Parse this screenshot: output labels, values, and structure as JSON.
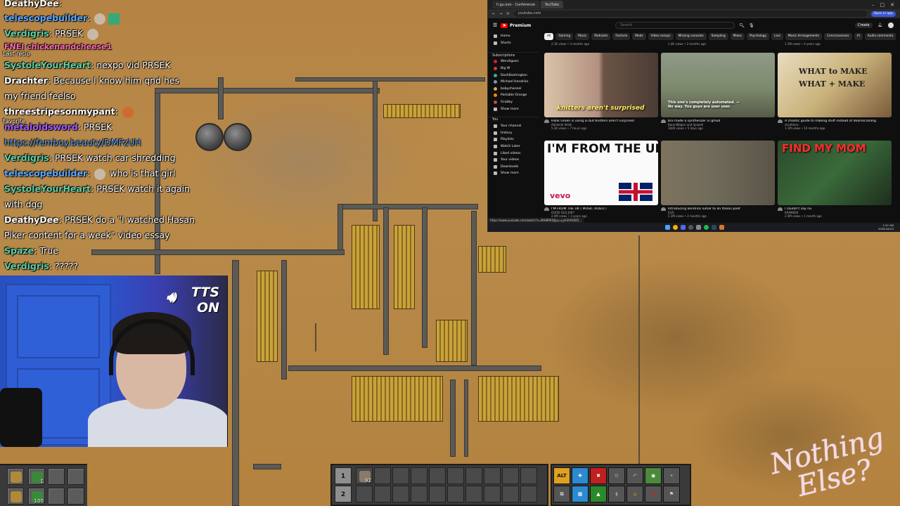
{
  "chat": {
    "messages": [
      {
        "user": "DeathyDee",
        "text": "",
        "color": "#ffffff"
      },
      {
        "user": "telescopebuilder",
        "text": "",
        "color": "#5da9ff"
      },
      {
        "user": "Verdigris",
        "text": "PRSEK",
        "color": "#5fcfa5"
      },
      {
        "user": "FNEI chickenandcheese1",
        "text": "",
        "color": "#ff6ab0"
      },
      {
        "user": "SystoleYourHeart",
        "text": "nexpo vid PRSEK",
        "color": "#5fcfa5"
      },
      {
        "user": "Drachter",
        "text": "Because I know him qnd hes my friend feelso",
        "color": "#ffffff"
      },
      {
        "user": "threestripesonmypant",
        "text": "",
        "color": "#ffffff"
      },
      {
        "user": "metaloidsword",
        "text": "PRSEK",
        "color": "#a15cff"
      },
      {
        "user": "",
        "text": "https://femboy.beauty/DMFzUH",
        "color": "#5da9ff"
      },
      {
        "user": "Verdigris",
        "text": "PRSEK watch car shredding",
        "color": "#5fcfa5"
      },
      {
        "user": "telescopebuilder",
        "text": "who is that girl",
        "color": "#5da9ff"
      },
      {
        "user": "SystoleYourHeart",
        "text": "PRSEK watch it again with dgg",
        "color": "#5fcfa5"
      },
      {
        "user": "DeathyDee",
        "text": "PRSEK do a \"I watched Hasan Piker content for a week\" video essay",
        "color": "#ffffff"
      },
      {
        "user": "Spaze",
        "text": "True",
        "color": "#5fcfa5"
      },
      {
        "user": "Verdigris",
        "text": "?????",
        "color": "#5fcfa5"
      }
    ],
    "labels": {
      "last_recip": "Last recip",
      "favorite": "Favorite"
    }
  },
  "tts": {
    "line1": "TTS",
    "line2": "ON",
    "icon": "speaker-icon"
  },
  "browser": {
    "tabs": [
      {
        "label": "Il gu.ovo - Conferenze",
        "active": false
      },
      {
        "label": "YouTube",
        "active": true
      }
    ],
    "url": "youtube.com",
    "open_app": "Open in app",
    "youtube": {
      "logo": "Premium",
      "search_placeholder": "Search",
      "create": "Create",
      "sidebar_top": [
        {
          "label": "Home",
          "icon": "home-icon"
        },
        {
          "label": "Shorts",
          "icon": "shorts-icon"
        }
      ],
      "subscriptions_title": "Subscriptions",
      "subscriptions": [
        {
          "label": "Wendigoon",
          "color": "#c23"
        },
        {
          "label": "Big W",
          "color": "#d33"
        },
        {
          "label": "DoshDoshington",
          "color": "#4a8"
        },
        {
          "label": "Michael Hendriks",
          "color": "#88c"
        },
        {
          "label": "bobychannel",
          "color": "#ca5"
        },
        {
          "label": "Portable Orange",
          "color": "#e80"
        },
        {
          "label": "Grubby",
          "color": "#c44"
        },
        {
          "label": "Show more",
          "color": "#999"
        }
      ],
      "you_title": "You",
      "you_items": [
        "Your channel",
        "History",
        "Playlists",
        "Watch Later",
        "Liked videos",
        "Your videos",
        "Downloads",
        "Show more"
      ],
      "chips": [
        "All",
        "Gaming",
        "Music",
        "Podcasts",
        "Factorio",
        "Mods",
        "Video essays",
        "Missing consoles",
        "Sampling",
        "Mixes",
        "Psychology",
        "Live",
        "Music Arrangements",
        "Consciousness",
        "AI",
        "Audio commenta"
      ],
      "above_meta": [
        "2.1K views • 3 months ago",
        "1.4K views • 2 months ago",
        "1.1M views • 4 years ago"
      ],
      "videos": [
        {
          "title": "Hank Green is using ai but Knitters aren't surprised",
          "channel": "Adelaide Velell",
          "meta": "5.2K views • 7 hours ago",
          "caption": "knitters aren't surprised",
          "thumb_color": "#6b5446"
        },
        {
          "title": "bro made a synthesizer in gmod",
          "channel": "BaronWagen and Spaaeh",
          "meta": "182K views • 5 days ago",
          "caption": "This one's completely automated. — No way. You guys are user user.",
          "thumb_color": "#7c8a6c"
        },
        {
          "title": "A chaotic guide to making stuff instead of doomscrolling",
          "channel": "struthless",
          "meta": "1.1M views • 10 months ago",
          "caption": "WHAT to MAKE WHAT + MAKE",
          "thumb_color": "#c9b27a"
        },
        {
          "title": "I'M FROM THE UK ( MUSIC VIDEO )",
          "channel": "GOOD OLD JOEY",
          "meta": "2.0M views • 3 years ago",
          "caption": "I'M FROM THE UK",
          "sub": "vevo",
          "thumb_color": "#ffffff"
        },
        {
          "title": "Introducing kendrick lumar to an Italian poet",
          "channel": "GUS",
          "meta": "5.3M views • 2 months ago",
          "caption": "",
          "thumb_color": "#6e6a5a"
        },
        {
          "title": "I couldn't say no.",
          "channel": "KRAWEEK",
          "meta": "2.4M views • 1 month ago",
          "caption": "FIND MY MOM",
          "thumb_color": "#2c4a2c"
        }
      ],
      "status_url": "https://www.youtube.com/watch?v=NIH89RIQJyy=yyhSXVk4E5...",
      "clock": {
        "time": "1:07 AM",
        "date": "2026-06-03"
      }
    }
  },
  "hotbar": {
    "left_slots": [
      {
        "icon": "pipe-icon",
        "count": ""
      },
      {
        "icon": "inserter-icon",
        "count": "1"
      },
      {
        "icon": "empty",
        "count": ""
      },
      {
        "icon": "empty",
        "count": ""
      },
      {
        "icon": "underground-icon",
        "count": ""
      },
      {
        "icon": "inserter-icon",
        "count": "100"
      },
      {
        "icon": "empty",
        "count": ""
      },
      {
        "icon": "empty",
        "count": ""
      }
    ],
    "quickbar": {
      "row1": "1",
      "row2": "2",
      "first_item_count": "92"
    },
    "shortcuts": [
      "ALT",
      "",
      "",
      "",
      "",
      "",
      "",
      "",
      "",
      "",
      "",
      "",
      "",
      "",
      ""
    ]
  },
  "watermark": {
    "line1": "Nothing",
    "line2": "Else?"
  }
}
